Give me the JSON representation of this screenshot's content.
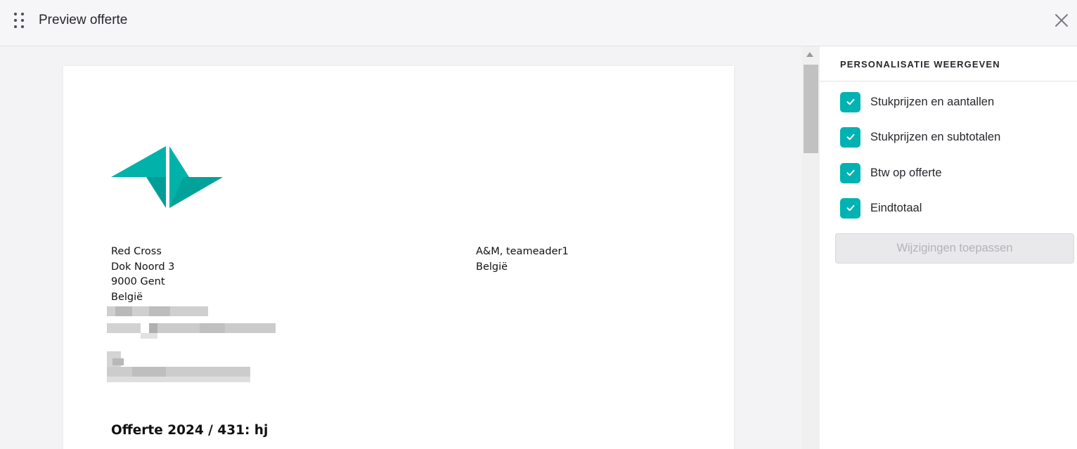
{
  "header": {
    "title": "Preview offerte",
    "drag_icon": "drag-handle-icon",
    "close_icon": "close-icon"
  },
  "document": {
    "sender": [
      "Red Cross",
      "Dok Noord 3",
      "9000 Gent",
      "België"
    ],
    "recipient": [
      "A&M, teameader1",
      "België"
    ],
    "title": "Offerte 2024 / 431: hj",
    "logo_color": "#00b2a9"
  },
  "panel": {
    "heading": "PERSONALISATIE WEERGEVEN",
    "options": [
      {
        "label": "Stukprijzen en aantallen",
        "checked": true
      },
      {
        "label": "Stukprijzen en subtotalen",
        "checked": true
      },
      {
        "label": "Btw op offerte",
        "checked": true
      },
      {
        "label": "Eindtotaal",
        "checked": true
      }
    ],
    "apply_label": "Wijzigingen toepassen"
  },
  "colors": {
    "accent": "#00b2b2",
    "disabled_text": "#b3b3b8"
  }
}
